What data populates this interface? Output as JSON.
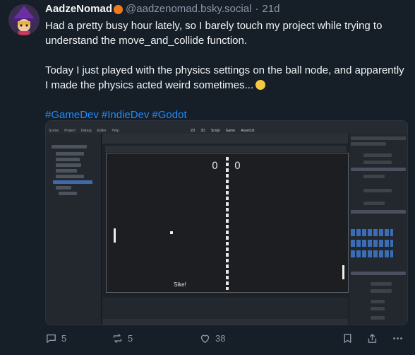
{
  "post": {
    "author_name": "AadzeNomad",
    "handle": "@aadzenomad.bsky.social",
    "separator": "·",
    "time": "21d",
    "paragraph_1": "Had a pretty busy hour lately, so I barely touch my project while trying to understand the move_and_collide function.",
    "paragraph_2": "Today I just played with the physics settings on the ball node, and apparently I made the physics acted weird sometimes...",
    "hashtags": [
      "#GameDev",
      "#IndieDev",
      "#Godot"
    ]
  },
  "screenshot": {
    "menu_items": [
      "Scene",
      "Project",
      "Debug",
      "Editor",
      "Help"
    ],
    "workspace_tabs": [
      "2D",
      "3D",
      "Script",
      "Game",
      "AssetLib"
    ],
    "score_left": "0",
    "score_right": "0",
    "game_text": "Sike!"
  },
  "actions": {
    "replies": "5",
    "reposts": "5",
    "likes": "38"
  },
  "icons": [
    "avatar",
    "pumpkin-emoji",
    "laughing-emoji",
    "reply-icon",
    "repost-icon",
    "like-icon",
    "bookmark-icon",
    "share-icon",
    "more-icon"
  ],
  "colors": {
    "background": "#161e27",
    "text": "#f1f3f5",
    "muted": "#8a97a8",
    "link": "#208bfe"
  }
}
